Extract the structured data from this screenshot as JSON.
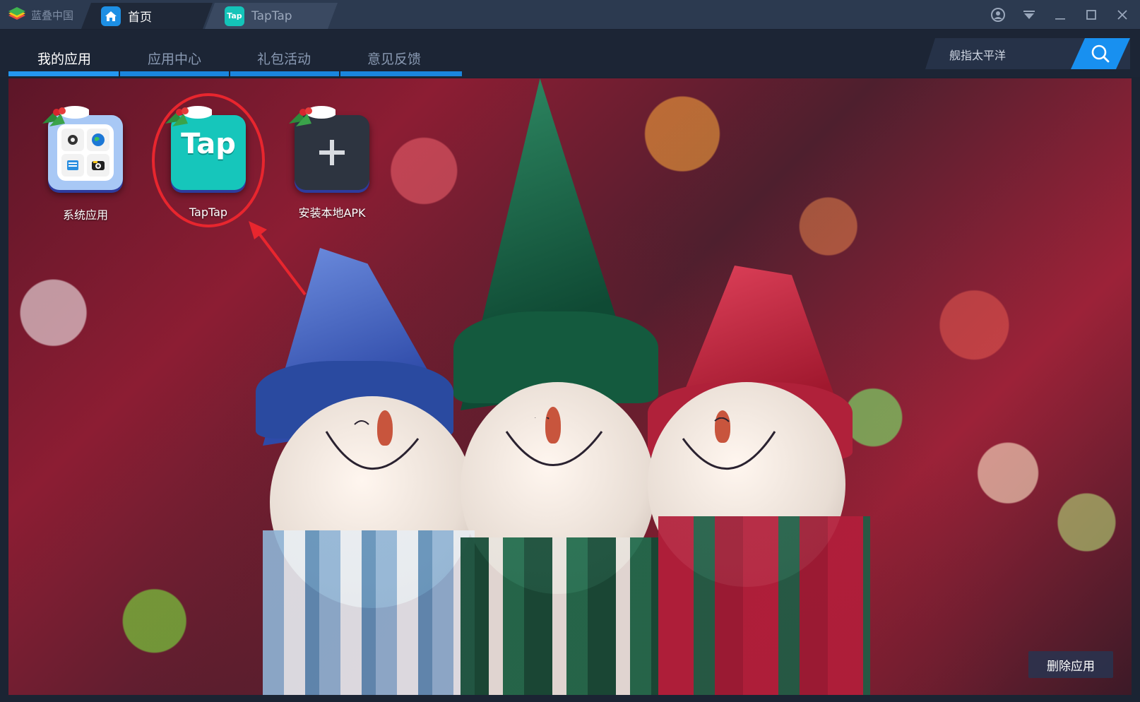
{
  "app_brand": "蓝叠中国",
  "tabs": [
    {
      "label": "首页"
    },
    {
      "label": "TapTap"
    }
  ],
  "nav": {
    "items": [
      "我的应用",
      "应用中心",
      "礼包活动",
      "意见反馈"
    ],
    "active_index": 0
  },
  "search": {
    "value": "舰指太平洋"
  },
  "apps": [
    {
      "label": "系统应用",
      "icon": "system-apps-icon"
    },
    {
      "label": "TapTap",
      "icon": "taptap-icon",
      "glyph": "Tap"
    },
    {
      "label": "安装本地APK",
      "icon": "plus-icon"
    }
  ],
  "delete_label": "删除应用",
  "colors": {
    "accent": "#1890f0",
    "taptap": "#14c4b9",
    "annotation": "#e8262e"
  }
}
